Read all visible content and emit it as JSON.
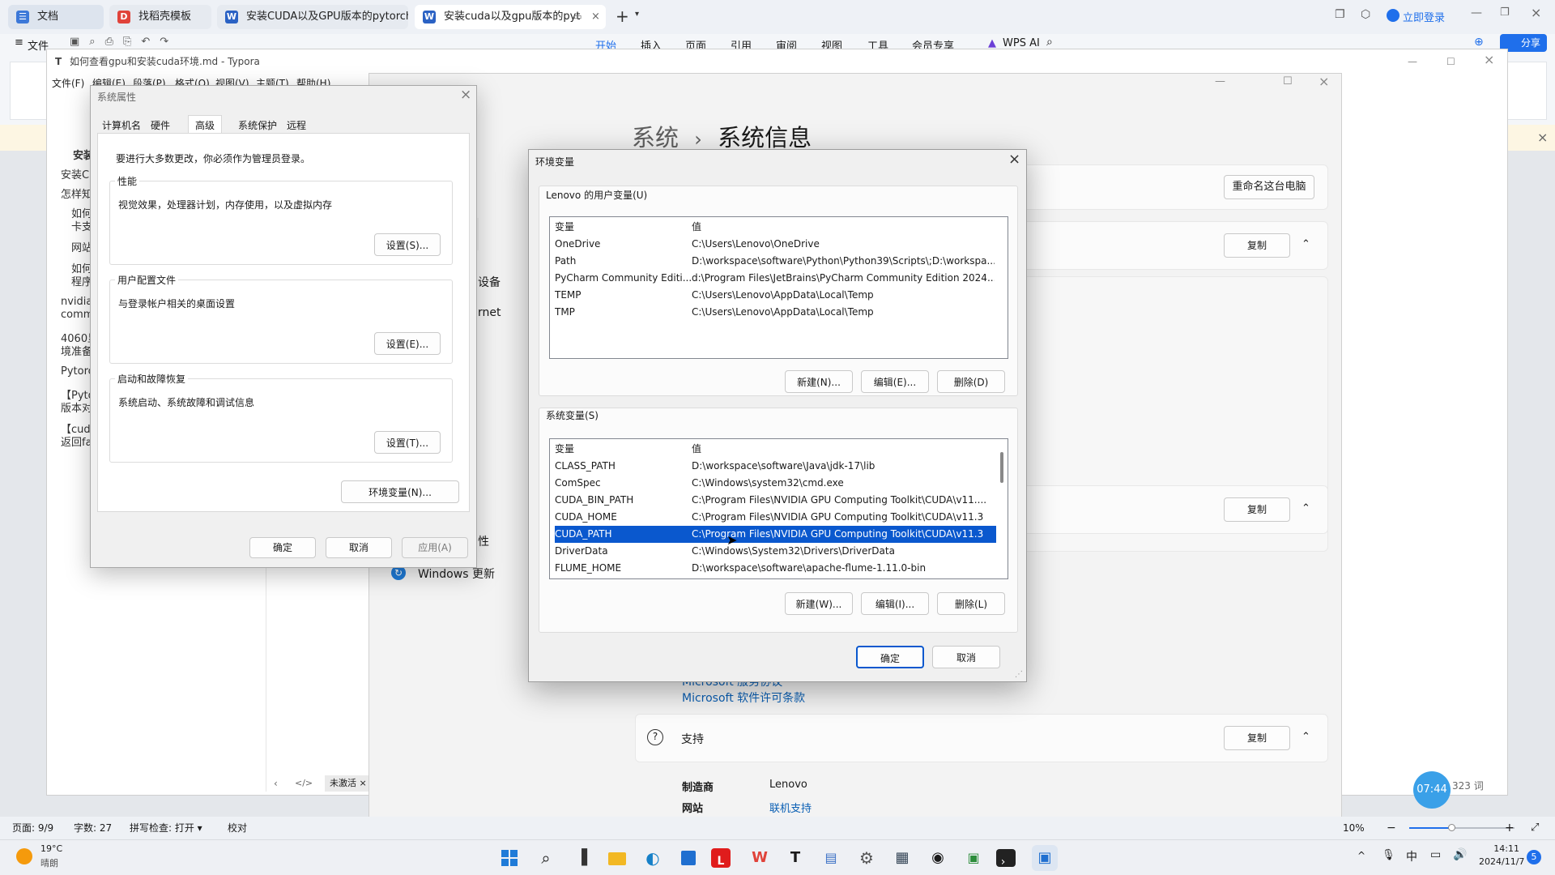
{
  "wps": {
    "tabs": [
      {
        "label": "文档",
        "color": "#3c78d8",
        "glyph": "☰"
      },
      {
        "label": "找稻壳模板",
        "color": "#e0433a",
        "glyph": "D"
      },
      {
        "label": "安装CUDA以及GPU版本的pytorch.d",
        "color": "#2b62c4",
        "glyph": "W"
      },
      {
        "label": "安装cuda以及gpu版本的pyt",
        "color": "#2b62c4",
        "glyph": "W"
      }
    ],
    "login": "立即登录",
    "ribbon": {
      "file": "文件",
      "tabs": [
        "开始",
        "插入",
        "页面",
        "引用",
        "审阅",
        "视图",
        "工具",
        "会员专享"
      ],
      "wps_ai": "WPS AI",
      "share": "分享"
    },
    "status": {
      "page": "页面: 9/9",
      "words": "字数: 27",
      "spell": "拼写检查: 打开 ▾",
      "proof": "校对",
      "zoom": "10%",
      "word_count_short": "323 词"
    },
    "clock_badge": "07:44"
  },
  "typora": {
    "title": "如何查看gpu和安装cuda环境.md - Typora",
    "menu": [
      "文件(F)",
      "编辑(E)",
      "段落(P)",
      "格式(O)",
      "视图(V)",
      "主题(T)",
      "帮助(H)"
    ],
    "sidebar": [
      "安装",
      "安装C",
      "怎样知",
      "如何",
      "卡支",
      "网站",
      "如何",
      "程序",
      "nvidia",
      "comm",
      "4060显",
      "境准备",
      "Pytorc",
      "【Pyto",
      "版本对",
      "【cud",
      "返回fa"
    ],
    "status_tag": "未激活 ×"
  },
  "settings": {
    "breadcrumb_parent": "系统",
    "breadcrumb_sep": "›",
    "breadcrumb_current": "系统信息",
    "rename_button": "重命名这台电脑",
    "copy": "复制",
    "left_partial": [
      "设备",
      "rnet",
      "性"
    ],
    "windows_update": "Windows 更新",
    "ms_link1": "Microsoft 服务协议",
    "ms_link2": "Microsoft 软件许可条款",
    "support_title": "支持",
    "manufacturer_label": "制造商",
    "manufacturer_value": "Lenovo",
    "website_label": "网站",
    "website_value": "联机支持"
  },
  "sysprop": {
    "title": "系统属性",
    "tabs": [
      "计算机名",
      "硬件",
      "高级",
      "系统保护",
      "远程"
    ],
    "active_tab": "高级",
    "notice": "要进行大多数更改，你必须作为管理员登录。",
    "perf_title": "性能",
    "perf_desc": "视觉效果，处理器计划，内存使用，以及虚拟内存",
    "perf_btn": "设置(S)...",
    "profile_title": "用户配置文件",
    "profile_desc": "与登录帐户相关的桌面设置",
    "profile_btn": "设置(E)...",
    "startup_title": "启动和故障恢复",
    "startup_desc": "系统启动、系统故障和调试信息",
    "startup_btn": "设置(T)...",
    "env_btn": "环境变量(N)...",
    "ok": "确定",
    "cancel": "取消",
    "apply": "应用(A)"
  },
  "envvar": {
    "title": "环境变量",
    "user_section": "Lenovo 的用户变量(U)",
    "col_var": "变量",
    "col_val": "值",
    "user_vars": [
      {
        "name": "OneDrive",
        "value": "C:\\Users\\Lenovo\\OneDrive"
      },
      {
        "name": "Path",
        "value": "D:\\workspace\\software\\Python\\Python39\\Scripts\\;D:\\workspa..."
      },
      {
        "name": "PyCharm Community Editi...",
        "value": "d:\\Program Files\\JetBrains\\PyCharm Community Edition 2024...."
      },
      {
        "name": "TEMP",
        "value": "C:\\Users\\Lenovo\\AppData\\Local\\Temp"
      },
      {
        "name": "TMP",
        "value": "C:\\Users\\Lenovo\\AppData\\Local\\Temp"
      }
    ],
    "user_new": "新建(N)...",
    "user_edit": "编辑(E)...",
    "user_delete": "删除(D)",
    "sys_section": "系统变量(S)",
    "sys_vars": [
      {
        "name": "CLASS_PATH",
        "value": "D:\\workspace\\software\\Java\\jdk-17\\lib"
      },
      {
        "name": "ComSpec",
        "value": "C:\\Windows\\system32\\cmd.exe"
      },
      {
        "name": "CUDA_BIN_PATH",
        "value": "C:\\Program Files\\NVIDIA GPU Computing Toolkit\\CUDA\\v11...."
      },
      {
        "name": "CUDA_HOME",
        "value": "C:\\Program Files\\NVIDIA GPU Computing Toolkit\\CUDA\\v11.3"
      },
      {
        "name": "CUDA_PATH",
        "value": "C:\\Program Files\\NVIDIA GPU Computing Toolkit\\CUDA\\v11.3"
      },
      {
        "name": "DriverData",
        "value": "C:\\Windows\\System32\\Drivers\\DriverData"
      },
      {
        "name": "FLUME_HOME",
        "value": "D:\\workspace\\software\\apache-flume-1.11.0-bin"
      }
    ],
    "selected_sys_var": "CUDA_PATH",
    "sys_new": "新建(W)...",
    "sys_edit": "编辑(I)...",
    "sys_delete": "删除(L)",
    "ok": "确定",
    "cancel": "取消"
  },
  "taskbar": {
    "weather_temp": "19°C",
    "weather_desc": "晴朗",
    "ime": "中",
    "time": "14:11",
    "date": "2024/11/7",
    "notif_count": "5"
  },
  "colors": {
    "accent": "#0a58ce",
    "link": "#0a5fb4",
    "wps_blue": "#1f6feb"
  }
}
